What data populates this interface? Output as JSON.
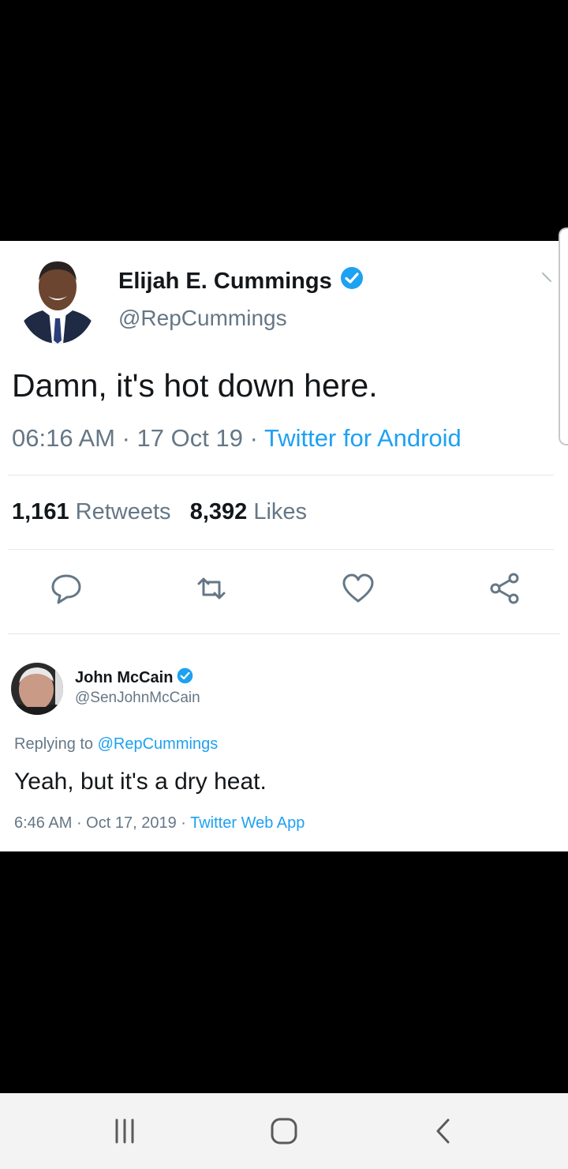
{
  "tweet": {
    "author_name": "Elijah E. Cummings",
    "handle": "@RepCummings",
    "text": "Damn, it's hot down here.",
    "time": "06:16 AM",
    "date": "17 Oct 19",
    "separator": " · ",
    "source": "Twitter for Android",
    "retweets_count": "1,161",
    "retweets_label": "Retweets",
    "likes_count": "8,392",
    "likes_label": "Likes"
  },
  "reply": {
    "author_name": "John McCain",
    "handle": "@SenJohnMcCain",
    "replying_prefix": "Replying to",
    "replying_to": "@RepCummings",
    "text": "Yeah, but it's a dry heat.",
    "time": "6:46 AM",
    "date": "Oct 17, 2019",
    "separator": " · ",
    "source": "Twitter Web App"
  },
  "icons": {
    "verified": "verified-badge-icon",
    "reply": "reply-icon",
    "retweet": "retweet-icon",
    "like": "heart-icon",
    "share": "share-icon",
    "menu": "chevron-down-icon",
    "nav_recents": "recents-icon",
    "nav_home": "home-icon",
    "nav_back": "back-icon"
  },
  "colors": {
    "background": "#000000",
    "card": "#ffffff",
    "accent": "#1da1f2",
    "text": "#14171a",
    "muted": "#657786",
    "navbar": "#f3f3f3"
  }
}
